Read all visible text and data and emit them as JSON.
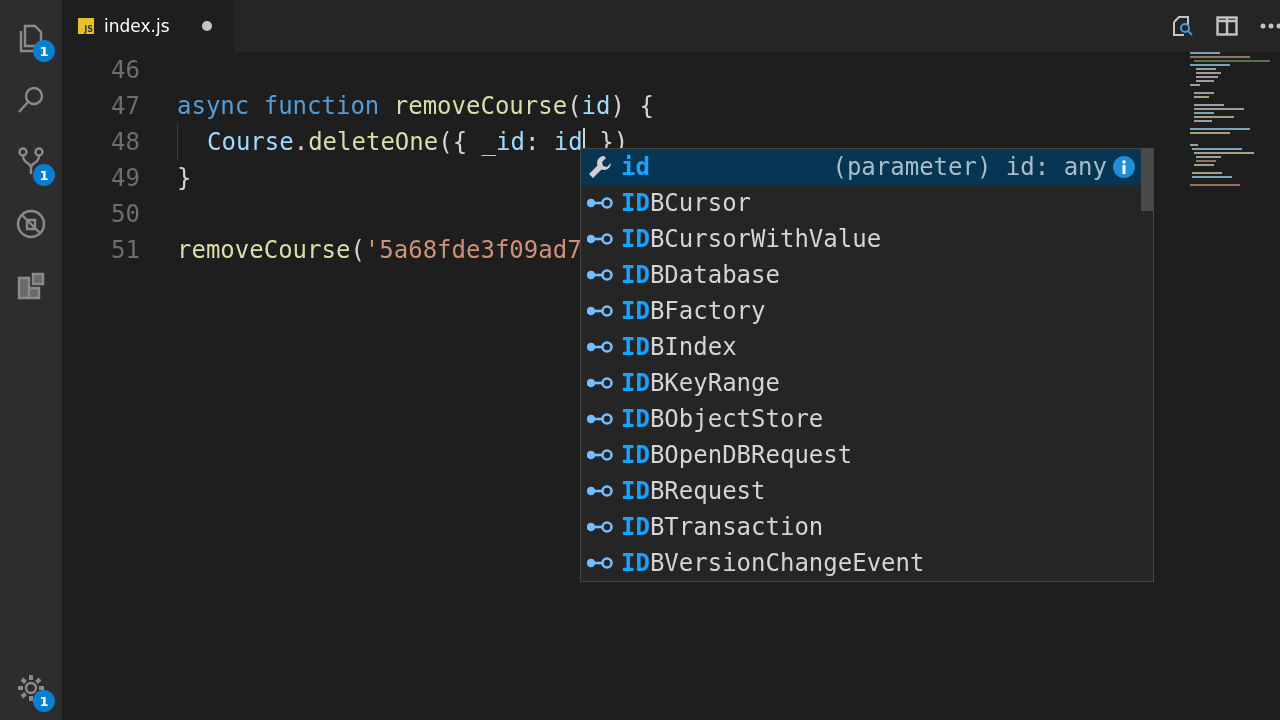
{
  "activity_bar": {
    "items": [
      {
        "kind": "files",
        "badge": "1"
      },
      {
        "kind": "search"
      },
      {
        "kind": "scm",
        "badge": "1"
      },
      {
        "kind": "debug"
      },
      {
        "kind": "extensions"
      }
    ],
    "bottom": {
      "kind": "settings",
      "badge": "1"
    }
  },
  "tabs": [
    {
      "icon_text": "JS",
      "title": "index.js",
      "modified": true,
      "selected": true
    }
  ],
  "editor": {
    "lines": [
      {
        "number": "46"
      },
      {
        "number": "47",
        "tokens": [
          {
            "text": "async function ",
            "kind": "keyword"
          },
          {
            "text": "removeCourse",
            "kind": "function"
          },
          {
            "text": "(",
            "kind": "plain"
          },
          {
            "text": "id",
            "kind": "variable"
          },
          {
            "text": ") {",
            "kind": "plain"
          }
        ]
      },
      {
        "number": "48",
        "indented": true,
        "cursor": true,
        "tokens": [
          {
            "text": "Course",
            "kind": "variable"
          },
          {
            "text": ".",
            "kind": "plain"
          },
          {
            "text": "deleteOne",
            "kind": "function"
          },
          {
            "text": "({ ",
            "kind": "plain"
          },
          {
            "text": "_id",
            "kind": "variable"
          },
          {
            "text": ": ",
            "kind": "plain"
          },
          {
            "text": "id",
            "kind": "variable"
          }
        ],
        "after_cursor": [
          {
            "text": " })",
            "kind": "plain"
          }
        ]
      },
      {
        "number": "49",
        "tokens": [
          {
            "text": "}",
            "kind": "plain"
          }
        ]
      },
      {
        "number": "50"
      },
      {
        "number": "51",
        "tokens": [
          {
            "text": "removeCourse",
            "kind": "function"
          },
          {
            "text": "(",
            "kind": "plain"
          },
          {
            "text": "'5a68fde3f09ad7",
            "kind": "string"
          }
        ]
      }
    ]
  },
  "suggestions": [
    {
      "kind": "parameter",
      "match": "id",
      "detail": "(parameter) id: any",
      "selected": true
    },
    {
      "kind": "interface",
      "match": "ID",
      "rest": "BCursor",
      "selected": false
    },
    {
      "kind": "interface",
      "match": "ID",
      "rest": "BCursorWithValue",
      "selected": false
    },
    {
      "kind": "interface",
      "match": "ID",
      "rest": "BDatabase",
      "selected": false
    },
    {
      "kind": "interface",
      "match": "ID",
      "rest": "BFactory",
      "selected": false
    },
    {
      "kind": "interface",
      "match": "ID",
      "rest": "BIndex",
      "selected": false
    },
    {
      "kind": "interface",
      "match": "ID",
      "rest": "BKeyRange",
      "selected": false
    },
    {
      "kind": "interface",
      "match": "ID",
      "rest": "BObjectStore",
      "selected": false
    },
    {
      "kind": "interface",
      "match": "ID",
      "rest": "BOpenDBRequest",
      "selected": false
    },
    {
      "kind": "interface",
      "match": "ID",
      "rest": "BRequest",
      "selected": false
    },
    {
      "kind": "interface",
      "match": "ID",
      "rest": "BTransaction",
      "selected": false
    },
    {
      "kind": "interface",
      "match": "ID",
      "rest": "BVersionChangeEvent",
      "selected": false
    }
  ]
}
